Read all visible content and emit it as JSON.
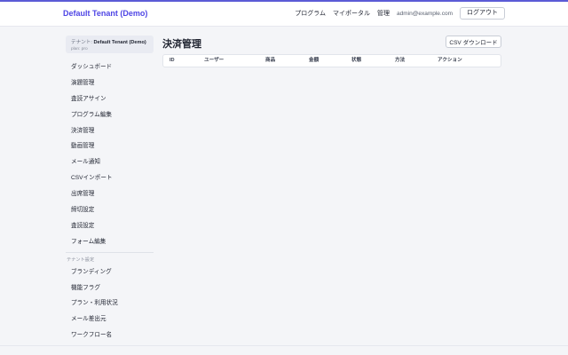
{
  "header": {
    "brand": "Default Tenant (Demo)",
    "nav": [
      "プログラム",
      "マイポータル",
      "管理"
    ],
    "email": "admin@example.com",
    "logout_label": "ログアウト"
  },
  "sidebar": {
    "tenant_prefix": "テナント: ",
    "tenant_name": "Default Tenant (Demo)",
    "plan": "plan: pro",
    "items": [
      "ダッシュボード",
      "演題管理",
      "査読アサイン",
      "プログラム編集",
      "決済管理",
      "動画管理",
      "メール通知",
      "CSVインポート",
      "出席管理",
      "締切設定",
      "査読設定",
      "フォーム編集"
    ],
    "section_label": "テナント設定",
    "settings_items": [
      "ブランディング",
      "機能フラグ",
      "プラン・利用状況",
      "メール差出元",
      "ワークフロー名"
    ]
  },
  "main": {
    "title": "決済管理",
    "csv_button": "CSV ダウンロード",
    "columns": [
      "ID",
      "ユーザー",
      "商品",
      "金額",
      "状態",
      "方法",
      "アクション"
    ]
  },
  "footer": {
    "text": ""
  }
}
